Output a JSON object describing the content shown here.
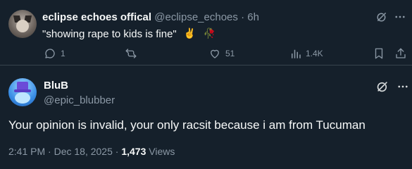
{
  "colors": {
    "background": "#15202b",
    "text_primary": "#f7f9f9",
    "text_muted": "#8b98a5",
    "divider": "#38444d"
  },
  "tweet": {
    "display_name": "eclipse echoes offical",
    "handle": "@eclipse_echoes",
    "separator": "·",
    "time": "6h",
    "text": "\"showing rape to kids is fine\"",
    "emojis": [
      "✌️",
      "🥀"
    ],
    "actions": {
      "replies": "1",
      "retweets": "",
      "likes": "51",
      "views": "1.4K"
    },
    "icons": [
      "grok-icon",
      "more-icon",
      "reply-icon",
      "retweet-icon",
      "like-icon",
      "views-icon",
      "bookmark-icon",
      "share-icon"
    ]
  },
  "reply": {
    "display_name": "BluB",
    "handle": "@epic_blubber",
    "text": "Your opinion is invalid, your only racsit because i am from Tucuman",
    "timestamp": "2:41 PM · Dec 18, 2025",
    "meta_separator": "·",
    "view_count": "1,473",
    "views_label": "Views",
    "icons": [
      "grok-icon",
      "more-icon"
    ]
  }
}
